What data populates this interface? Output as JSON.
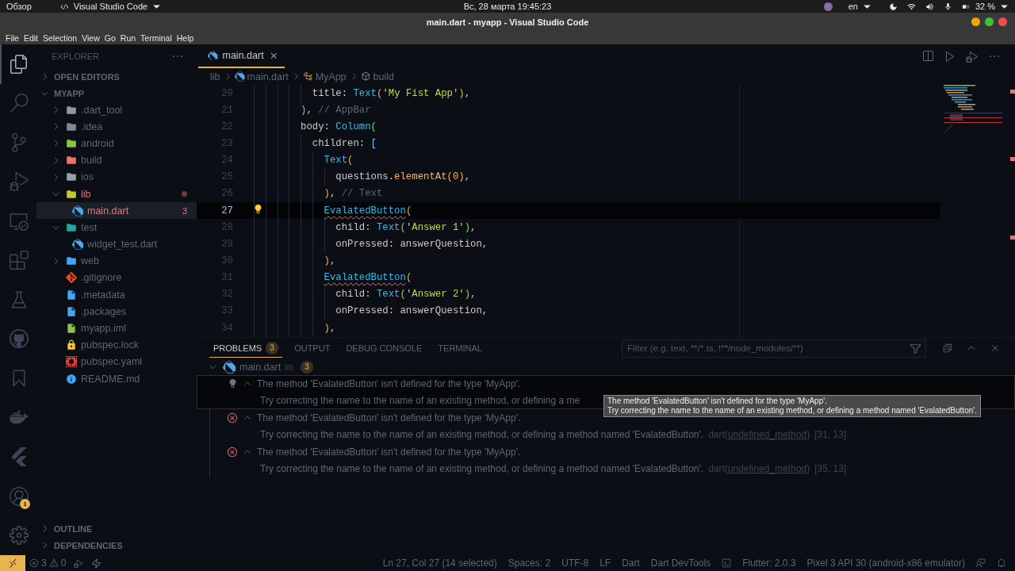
{
  "system_bar": {
    "activities": "Обзор",
    "app_menu": "Visual Studio Code",
    "clock": "Вс, 28 марта  19:45:23",
    "keyboard": "en",
    "battery": "32 %"
  },
  "window": {
    "title": "main.dart - myapp - Visual Studio Code"
  },
  "menu": [
    "File",
    "Edit",
    "Selection",
    "View",
    "Go",
    "Run",
    "Terminal",
    "Help"
  ],
  "activity_bar": [
    {
      "kind": "files",
      "selected": true
    },
    {
      "kind": "search",
      "selected": false
    },
    {
      "kind": "scm",
      "selected": false
    },
    {
      "kind": "debug",
      "selected": false
    },
    {
      "kind": "remote",
      "selected": false
    },
    {
      "kind": "extensions",
      "selected": false
    },
    {
      "kind": "testing",
      "selected": false
    },
    {
      "kind": "github",
      "selected": false
    },
    {
      "kind": "bookmark",
      "selected": false
    },
    {
      "kind": "docker",
      "selected": false
    },
    {
      "kind": "flutter",
      "selected": false
    }
  ],
  "activity_bottom": [
    {
      "kind": "account",
      "badge": "1"
    },
    {
      "kind": "settings"
    }
  ],
  "sidebar": {
    "title": "EXPLORER",
    "open_editors": {
      "label": "OPEN EDITORS",
      "expanded": false
    },
    "project": {
      "label": "MYAPP",
      "expanded": true,
      "items": [
        {
          "name": ".dart_tool",
          "kind": "folder",
          "color": "#8a9aa8",
          "expanded": false,
          "selected": false,
          "error": false
        },
        {
          "name": ".idea",
          "kind": "folder",
          "color": "#7d8b96",
          "expanded": false,
          "selected": false,
          "error": false
        },
        {
          "name": "android",
          "kind": "folder",
          "color": "#8bc34a",
          "expanded": false,
          "selected": false,
          "error": false
        },
        {
          "name": "build",
          "kind": "folder",
          "color": "#e57373",
          "expanded": false,
          "selected": false,
          "error": false
        },
        {
          "name": "ios",
          "kind": "folder",
          "color": "#90a4ae",
          "expanded": false,
          "selected": false,
          "error": false
        },
        {
          "name": "lib",
          "kind": "folder",
          "color": "#c0ca33",
          "expanded": true,
          "selected": false,
          "error": true,
          "children": [
            {
              "name": "main.dart",
              "kind": "dart",
              "color": "#4fa8e8",
              "selected": true,
              "error": true,
              "badge": "3"
            }
          ]
        },
        {
          "name": "test",
          "kind": "folder",
          "color": "#26a69a",
          "expanded": true,
          "selected": false,
          "error": false,
          "children": [
            {
              "name": "widget_test.dart",
              "kind": "dart",
              "color": "#4fa8e8",
              "selected": false,
              "error": false
            }
          ]
        },
        {
          "name": "web",
          "kind": "folder",
          "color": "#42a5f5",
          "expanded": false,
          "selected": false,
          "error": false
        },
        {
          "name": ".gitignore",
          "kind": "git",
          "color": "#e64a19",
          "selected": false,
          "error": false
        },
        {
          "name": ".metadata",
          "kind": "doc",
          "color": "#42a5f5",
          "selected": false,
          "error": false
        },
        {
          "name": ".packages",
          "kind": "doc",
          "color": "#42a5f5",
          "selected": false,
          "error": false
        },
        {
          "name": "myapp.iml",
          "kind": "xml",
          "color": "#8bc34a",
          "selected": false,
          "error": false
        },
        {
          "name": "pubspec.lock",
          "kind": "lock",
          "color": "#ffca28",
          "selected": false,
          "error": false
        },
        {
          "name": "pubspec.yaml",
          "kind": "braces",
          "color": "#f44336",
          "selected": false,
          "error": false
        },
        {
          "name": "README.md",
          "kind": "info",
          "color": "#42a5f5",
          "selected": false,
          "error": false
        }
      ]
    },
    "bottom_sections": [
      {
        "label": "OUTLINE",
        "expanded": false
      },
      {
        "label": "DEPENDENCIES",
        "expanded": false
      }
    ]
  },
  "editor": {
    "tabs": [
      {
        "label": "main.dart",
        "selected": true
      }
    ],
    "breadcrumbs": [
      {
        "label": "lib",
        "kind": "folder"
      },
      {
        "label": "main.dart",
        "kind": "dart"
      },
      {
        "label": "MyApp",
        "kind": "class"
      },
      {
        "label": "build",
        "kind": "method"
      }
    ],
    "lines": [
      {
        "number": "20",
        "current": false,
        "lightbulb": false,
        "tokens": [
          {
            "text": "          title: ",
            "kind": "plain"
          },
          {
            "text": "Text",
            "kind": "type"
          },
          {
            "text": "(",
            "kind": "bracket1"
          },
          {
            "text": "'My Fist App'",
            "kind": "string"
          },
          {
            "text": ")",
            "kind": "bracket1"
          },
          {
            "text": ",",
            "kind": "plain"
          }
        ]
      },
      {
        "number": "21",
        "current": false,
        "lightbulb": false,
        "tokens": [
          {
            "text": "        )",
            "kind": "bracket2"
          },
          {
            "text": ", ",
            "kind": "plain"
          },
          {
            "text": "// AppBar",
            "kind": "comment"
          }
        ]
      },
      {
        "number": "22",
        "current": false,
        "lightbulb": false,
        "tokens": [
          {
            "text": "        body: ",
            "kind": "plain"
          },
          {
            "text": "Column",
            "kind": "type"
          },
          {
            "text": "(",
            "kind": "bracket2"
          }
        ]
      },
      {
        "number": "23",
        "current": false,
        "lightbulb": false,
        "tokens": [
          {
            "text": "          children: ",
            "kind": "plain"
          },
          {
            "text": "[",
            "kind": "bracket3"
          }
        ]
      },
      {
        "number": "24",
        "current": false,
        "lightbulb": false,
        "tokens": [
          {
            "text": "            Text",
            "kind": "type"
          },
          {
            "text": "(",
            "kind": "bracket1"
          }
        ]
      },
      {
        "number": "25",
        "current": false,
        "lightbulb": false,
        "tokens": [
          {
            "text": "              questions.",
            "kind": "plain"
          },
          {
            "text": "elementAt(0)",
            "kind": "func"
          },
          {
            "text": ",",
            "kind": "plain"
          }
        ]
      },
      {
        "number": "26",
        "current": false,
        "lightbulb": false,
        "tokens": [
          {
            "text": "            )",
            "kind": "bracket1"
          },
          {
            "text": ", ",
            "kind": "plain"
          },
          {
            "text": "// Text",
            "kind": "comment"
          }
        ]
      },
      {
        "number": "27",
        "current": true,
        "lightbulb": true,
        "tokens": [
          {
            "text": "            EvalatedButton",
            "kind": "error"
          },
          {
            "text": "(",
            "kind": "bracket1"
          }
        ]
      },
      {
        "number": "28",
        "current": false,
        "lightbulb": false,
        "tokens": [
          {
            "text": "              child: ",
            "kind": "plain"
          },
          {
            "text": "Text",
            "kind": "type"
          },
          {
            "text": "(",
            "kind": "bracket2"
          },
          {
            "text": "'Answer 1'",
            "kind": "string"
          },
          {
            "text": ")",
            "kind": "bracket2"
          },
          {
            "text": ",",
            "kind": "plain"
          }
        ]
      },
      {
        "number": "29",
        "current": false,
        "lightbulb": false,
        "tokens": [
          {
            "text": "              onPressed: answerQuestion,",
            "kind": "plain"
          }
        ]
      },
      {
        "number": "30",
        "current": false,
        "lightbulb": false,
        "tokens": [
          {
            "text": "            )",
            "kind": "bracket1"
          },
          {
            "text": ",",
            "kind": "plain"
          }
        ]
      },
      {
        "number": "31",
        "current": false,
        "lightbulb": false,
        "tokens": [
          {
            "text": "            EvalatedButton",
            "kind": "error"
          },
          {
            "text": "(",
            "kind": "bracket1"
          }
        ]
      },
      {
        "number": "32",
        "current": false,
        "lightbulb": false,
        "tokens": [
          {
            "text": "              child: ",
            "kind": "plain"
          },
          {
            "text": "Text",
            "kind": "type"
          },
          {
            "text": "(",
            "kind": "bracket2"
          },
          {
            "text": "'Answer 2'",
            "kind": "string"
          },
          {
            "text": ")",
            "kind": "bracket2"
          },
          {
            "text": ",",
            "kind": "plain"
          }
        ]
      },
      {
        "number": "33",
        "current": false,
        "lightbulb": false,
        "tokens": [
          {
            "text": "              onPressed: answerQuestion,",
            "kind": "plain"
          }
        ]
      },
      {
        "number": "34",
        "current": false,
        "lightbulb": false,
        "tokens": [
          {
            "text": "            )",
            "kind": "bracket1"
          },
          {
            "text": ",",
            "kind": "plain"
          }
        ]
      }
    ]
  },
  "panel": {
    "tabs": [
      {
        "label": "PROBLEMS",
        "badge": "3",
        "selected": true
      },
      {
        "label": "OUTPUT",
        "selected": false
      },
      {
        "label": "DEBUG CONSOLE",
        "selected": false
      },
      {
        "label": "TERMINAL",
        "selected": false
      }
    ],
    "filter": {
      "placeholder": "Filter (e.g. text, **/*.ts, !**/node_modules/**)"
    },
    "group": {
      "file": "main.dart",
      "folder": "lib",
      "count": "3",
      "expanded": true
    },
    "problems": [
      {
        "kind": "lightbulb",
        "selected": true,
        "message": "The method 'EvalatedButton' isn't defined for the type 'MyApp'.",
        "detail": "Try correcting the name to the name of an existing method, or defining a me"
      },
      {
        "kind": "error",
        "selected": false,
        "message": "The method 'EvalatedButton' isn't defined for the type 'MyApp'.",
        "detail": "Try correcting the name to the name of an existing method, or defining a method named 'EvalatedButton'.",
        "source": {
          "prefix": "dart(",
          "link": "undefined_method",
          "suffix": ")"
        },
        "position": "[31, 13]"
      },
      {
        "kind": "error",
        "selected": false,
        "message": "The method 'EvalatedButton' isn't defined for the type 'MyApp'.",
        "detail": "Try correcting the name to the name of an existing method, or defining a method named 'EvalatedButton'.",
        "source": {
          "prefix": "dart(",
          "link": "undefined_method",
          "suffix": ")"
        },
        "position": "[35, 13]"
      }
    ],
    "tooltip": [
      "The method 'EvalatedButton' isn't defined for the type 'MyApp'.",
      "Try correcting the name to the name of an existing method, or defining a method named 'EvalatedButton'."
    ]
  },
  "status_bar": {
    "errors": "3",
    "warnings": "0",
    "items": [
      {
        "kind": "text",
        "label": "Ln 27, Col 27 (14 selected)"
      },
      {
        "kind": "text",
        "label": "Spaces: 2"
      },
      {
        "kind": "text",
        "label": "UTF-8"
      },
      {
        "kind": "text",
        "label": "LF"
      },
      {
        "kind": "text",
        "label": "Dart"
      },
      {
        "kind": "text",
        "label": "Dart DevTools"
      },
      {
        "kind": "terminal"
      },
      {
        "kind": "text",
        "label": "Flutter: 2.0.3"
      },
      {
        "kind": "text",
        "label": "Pixel 3 API 30 (android-x86 emulator)"
      },
      {
        "kind": "feedback"
      },
      {
        "kind": "bell"
      }
    ]
  }
}
